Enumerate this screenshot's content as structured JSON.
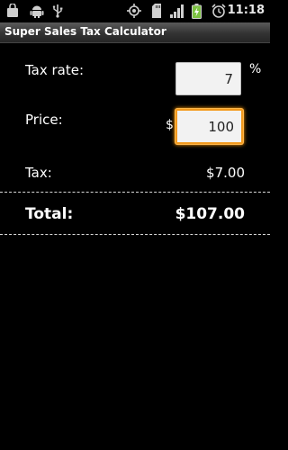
{
  "status_bar": {
    "time": "11:18",
    "icons": [
      "bag-icon",
      "android-icon",
      "usb-icon",
      "gps-icon",
      "sd-card-icon",
      "signal-icon",
      "battery-charging-icon",
      "alarm-icon"
    ]
  },
  "app": {
    "title": "Super Sales Tax Calculator"
  },
  "form": {
    "tax_rate_label": "Tax rate:",
    "tax_rate_value": "7",
    "tax_rate_unit": "%",
    "price_label": "Price:",
    "price_currency": "$",
    "price_value": "100",
    "tax_label": "Tax:",
    "tax_value": "$7.00",
    "total_label": "Total:",
    "total_value": "$107.00"
  },
  "colors": {
    "background": "#000000",
    "focus_accent": "#f39a1e",
    "battery_green": "#7cc242"
  }
}
